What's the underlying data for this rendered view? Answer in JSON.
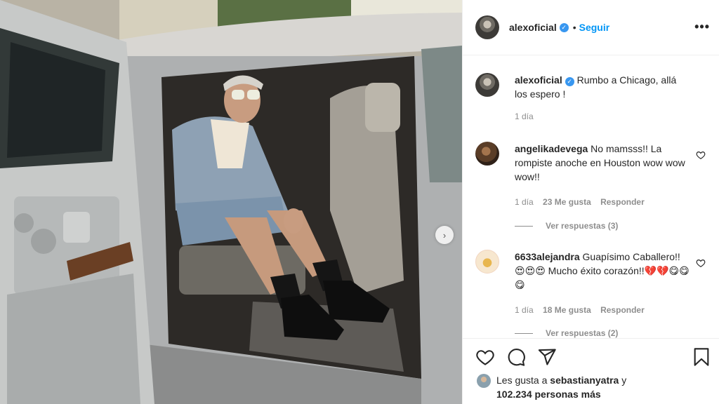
{
  "post": {
    "username": "alexoficial",
    "follow_label": "Seguir",
    "separator": "•",
    "more_icon": "•••"
  },
  "caption": {
    "username": "alexoficial",
    "text": "Rumbo a Chicago, allá los espero !",
    "time": "1 día"
  },
  "comments": [
    {
      "username": "angelikadevega",
      "text": "No mamsss!! La rompiste anoche en Houston wow wow wow!!",
      "time": "1 día",
      "likes": "23 Me gusta",
      "reply_label": "Responder",
      "view_replies": "Ver respuestas (3)"
    },
    {
      "username": "6633alejandra",
      "text": "Guapísimo Caballero!!😍😍😍 Mucho éxito corazón!!💔💔😋😋😋",
      "time": "1 día",
      "likes": "18 Me gusta",
      "reply_label": "Responder",
      "view_replies": "Ver respuestas (2)"
    }
  ],
  "likes_line": {
    "prefix": "Les gusta a",
    "user": "sebastianyatra",
    "conj": "y",
    "count": "102.234 personas más"
  },
  "icons": [
    "heart-icon",
    "comment-icon",
    "share-icon",
    "bookmark-icon",
    "verified-badge-icon",
    "chevron-right-icon",
    "more-options-icon"
  ],
  "colors": {
    "accent": "#0095f6",
    "verified": "#3897f0",
    "muted": "#8e8e8e",
    "text": "#262626"
  }
}
